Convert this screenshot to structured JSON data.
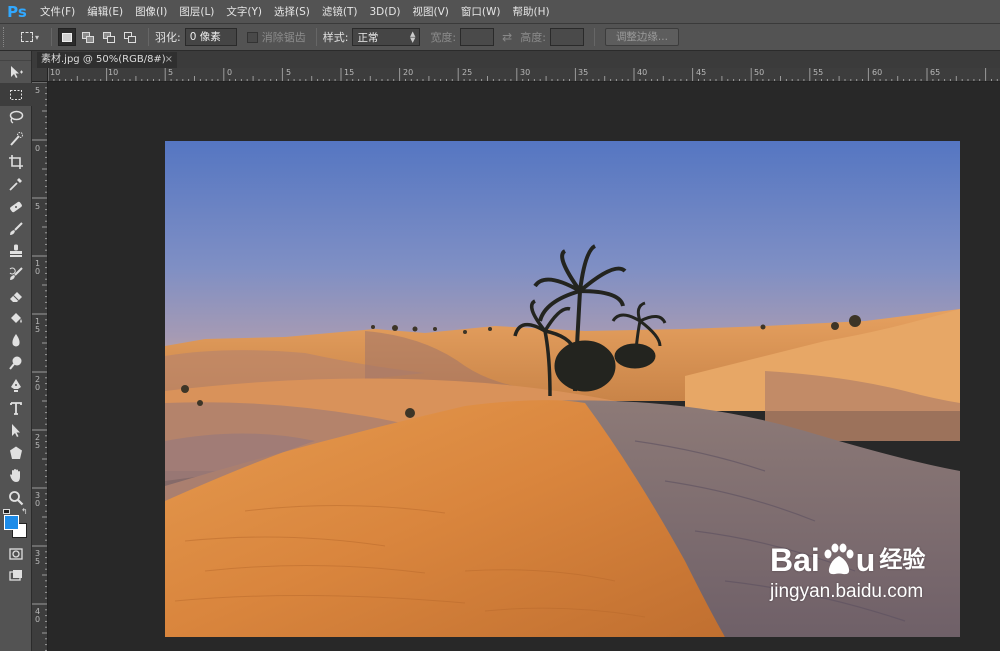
{
  "app": {
    "logo": "Ps"
  },
  "menu": [
    "文件(F)",
    "编辑(E)",
    "图像(I)",
    "图层(L)",
    "文字(Y)",
    "选择(S)",
    "滤镜(T)",
    "3D(D)",
    "视图(V)",
    "窗口(W)",
    "帮助(H)"
  ],
  "options": {
    "feather_label": "羽化:",
    "feather_value": "0 像素",
    "antialias_label": "消除锯齿",
    "style_label": "样式:",
    "style_value": "正常",
    "width_label": "宽度:",
    "height_label": "高度:",
    "refine_label": "调整边缘..."
  },
  "document": {
    "tab_title": "素材.jpg @ 50%(RGB/8#)",
    "close_glyph": "×"
  },
  "rulers": {
    "horizontal": [
      "10",
      "5",
      "0",
      "5",
      "10",
      "15",
      "20",
      "25",
      "30",
      "35",
      "40",
      "45",
      "50",
      "55",
      "60",
      "65"
    ],
    "vertical": [
      "5",
      "0",
      "5",
      "1 0",
      "1 5",
      "2 0",
      "2 5",
      "3 0",
      "3 5",
      "4 0"
    ]
  },
  "tools": [
    "move-icon",
    "rect-marquee-icon",
    "lasso-icon",
    "quick-select-icon",
    "crop-icon",
    "eyedropper-icon",
    "healing-brush-icon",
    "brush-icon",
    "clone-stamp-icon",
    "history-brush-icon",
    "eraser-icon",
    "paint-bucket-icon",
    "blur-icon",
    "dodge-icon",
    "pen-icon",
    "type-icon",
    "path-select-icon",
    "shape-icon",
    "hand-icon",
    "zoom-icon"
  ],
  "colors": {
    "foreground": "#1e8ce8",
    "background": "#ffffff"
  },
  "watermark": {
    "brand_left": "Bai",
    "brand_right": "u",
    "brand_cn": "经验",
    "url": "jingyan.baidu.com"
  }
}
